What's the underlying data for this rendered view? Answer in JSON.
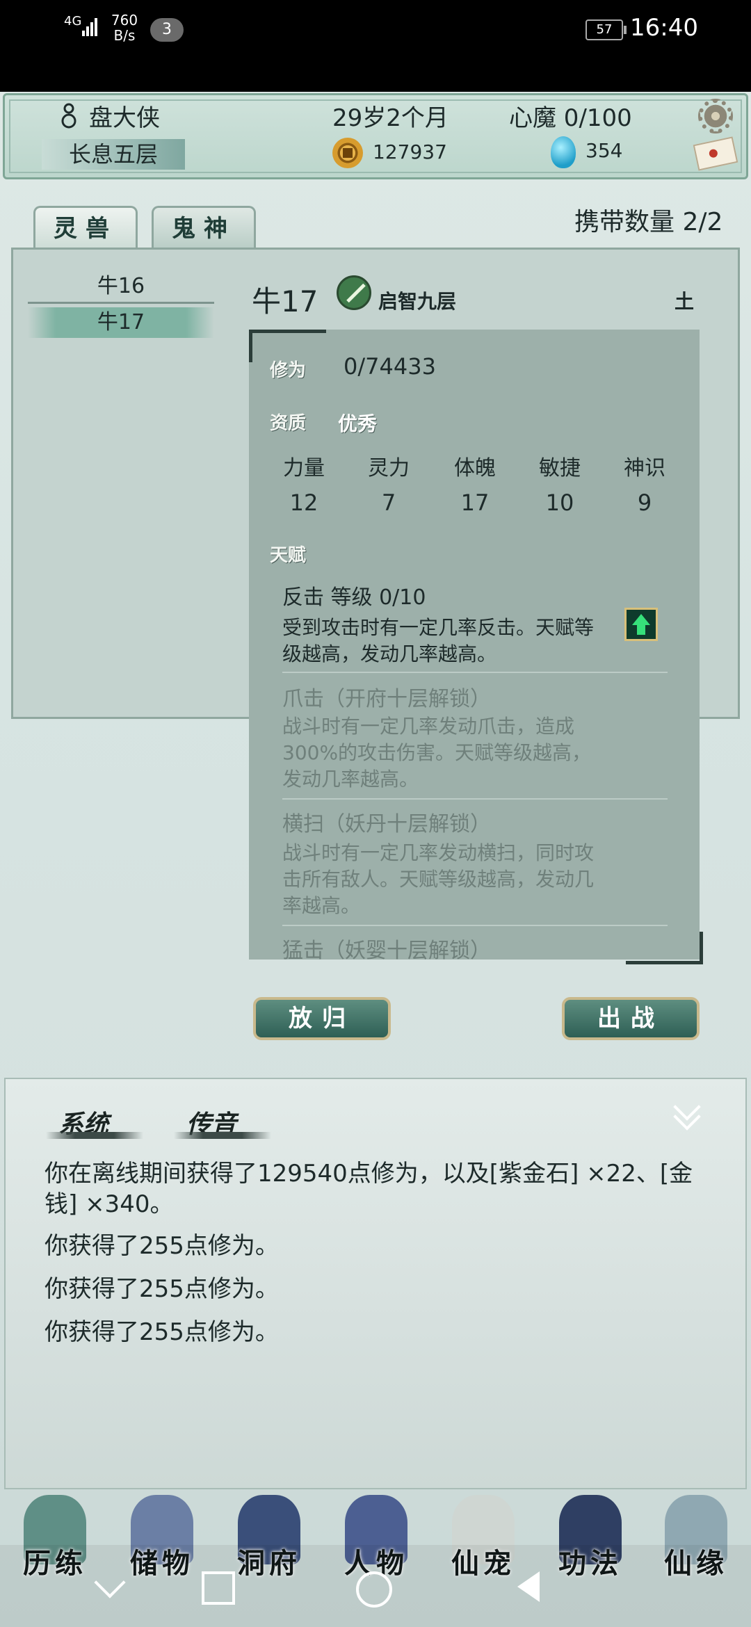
{
  "status_bar": {
    "network": "4G",
    "speed_value": "760",
    "speed_unit": "B/s",
    "notification_count": "3",
    "battery": "57",
    "time": "16:40"
  },
  "header": {
    "player_name": "盘大侠",
    "realm": "长息五层",
    "age": "29岁2个月",
    "heart_demon": "心魔  0/100",
    "coins": "127937",
    "spirit_stones": "354"
  },
  "tabs": {
    "lingshou": "灵兽",
    "guishen": "鬼神"
  },
  "carry": "携带数量    2/2",
  "pets": [
    "牛16",
    "牛17"
  ],
  "pet_detail": {
    "name": "牛17",
    "stage": "启智九层",
    "element": "土",
    "cultivation_label": "修为",
    "cultivation_value": "0/74433",
    "aptitude_label": "资质",
    "aptitude_value": "优秀",
    "stats": [
      {
        "name": "力量",
        "value": "12"
      },
      {
        "name": "灵力",
        "value": "7"
      },
      {
        "name": "体魄",
        "value": "17"
      },
      {
        "name": "敏捷",
        "value": "10"
      },
      {
        "name": "神识",
        "value": "9"
      }
    ],
    "talent_label": "天赋",
    "talents": [
      {
        "name": "反击    等级  0/10",
        "desc": "受到攻击时有一定几率反击。天赋等级越高，发动几率越高。"
      },
      {
        "name": "爪击（开府十层解锁）",
        "desc": "战斗时有一定几率发动爪击，造成300%的攻击伤害。天赋等级越高，发动几率越高。"
      },
      {
        "name": "横扫（妖丹十层解锁）",
        "desc": "战斗时有一定几率发动横扫，同时攻击所有敌人。天赋等级越高，发动几率越高。"
      },
      {
        "name": "猛击（妖婴十层解锁）"
      }
    ]
  },
  "buttons": {
    "release": "放归",
    "battle": "出战"
  },
  "messages": {
    "tab_system": "系统",
    "tab_chuanyin": "传音",
    "lines": [
      "你在离线期间获得了129540点修为，以及[紫金石] ×22、[金钱] ×340。",
      "你获得了255点修为。",
      "你获得了255点修为。",
      "你获得了255点修为。"
    ]
  },
  "nav": [
    {
      "label": "历练",
      "color": "#5f8f86"
    },
    {
      "label": "储物",
      "color": "#6b7fa5"
    },
    {
      "label": "洞府",
      "color": "#3a4f7a"
    },
    {
      "label": "人物",
      "color": "#4c5f92"
    },
    {
      "label": "仙宠",
      "color": "#cfd6d2"
    },
    {
      "label": "功法",
      "color": "#2f3f63"
    },
    {
      "label": "仙缘",
      "color": "#8fa8b2"
    }
  ]
}
